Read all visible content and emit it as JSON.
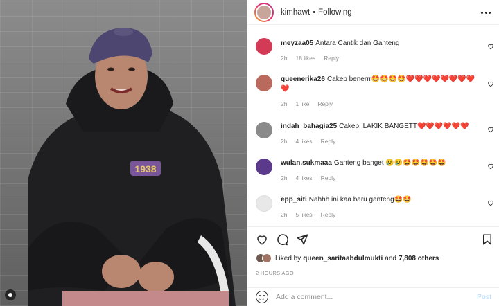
{
  "header": {
    "username": "kimhawt",
    "separator": "•",
    "follow_status": "Following"
  },
  "comments": [
    {
      "username": "meyzaa05",
      "text": "Antara Cantik dan Ganteng",
      "time": "2h",
      "likes": "18 likes",
      "reply": "Reply",
      "avatar_color": "#d23a55"
    },
    {
      "username": "queenerika26",
      "text": "Cakep benerrr🤩🤩🤩🤩❤️❤️❤️❤️❤️❤️❤️❤️❤️",
      "time": "2h",
      "likes": "1 like",
      "reply": "Reply",
      "avatar_color": "#b96a5c"
    },
    {
      "username": "indah_bahagia25",
      "text": "Cakep, LAKIK BANGETT❤️❤️❤️❤️❤️❤️",
      "time": "2h",
      "likes": "4 likes",
      "reply": "Reply",
      "avatar_color": "#8a8a8a"
    },
    {
      "username": "wulan.sukmaaa",
      "text": "Ganteng banget 😢😢🤩🤩🤩🤩🤩",
      "time": "2h",
      "likes": "4 likes",
      "reply": "Reply",
      "avatar_color": "#5b3a8c"
    },
    {
      "username": "epp_siti",
      "text": "Nahhh ini kaa baru ganteng🤩🤩",
      "time": "2h",
      "likes": "5 likes",
      "reply": "Reply",
      "avatar_color": "#e0e0e0"
    }
  ],
  "likes": {
    "prefix": "Liked by",
    "user": "queen_saritaabdulmukti",
    "middle": "and",
    "others": "7,808 others"
  },
  "timestamp": "2 HOURS AGO",
  "add_comment": {
    "placeholder": "Add a comment...",
    "post_label": "Post"
  },
  "icons": {
    "like": "heart-icon",
    "comment": "comment-icon",
    "share": "share-icon",
    "save": "bookmark-icon",
    "emoji": "emoji-icon",
    "more": "more-options-icon"
  },
  "colors": {
    "post_button": "#b3dbff",
    "muted_text": "#8e8e8e",
    "story_ring": "#e1306c"
  }
}
